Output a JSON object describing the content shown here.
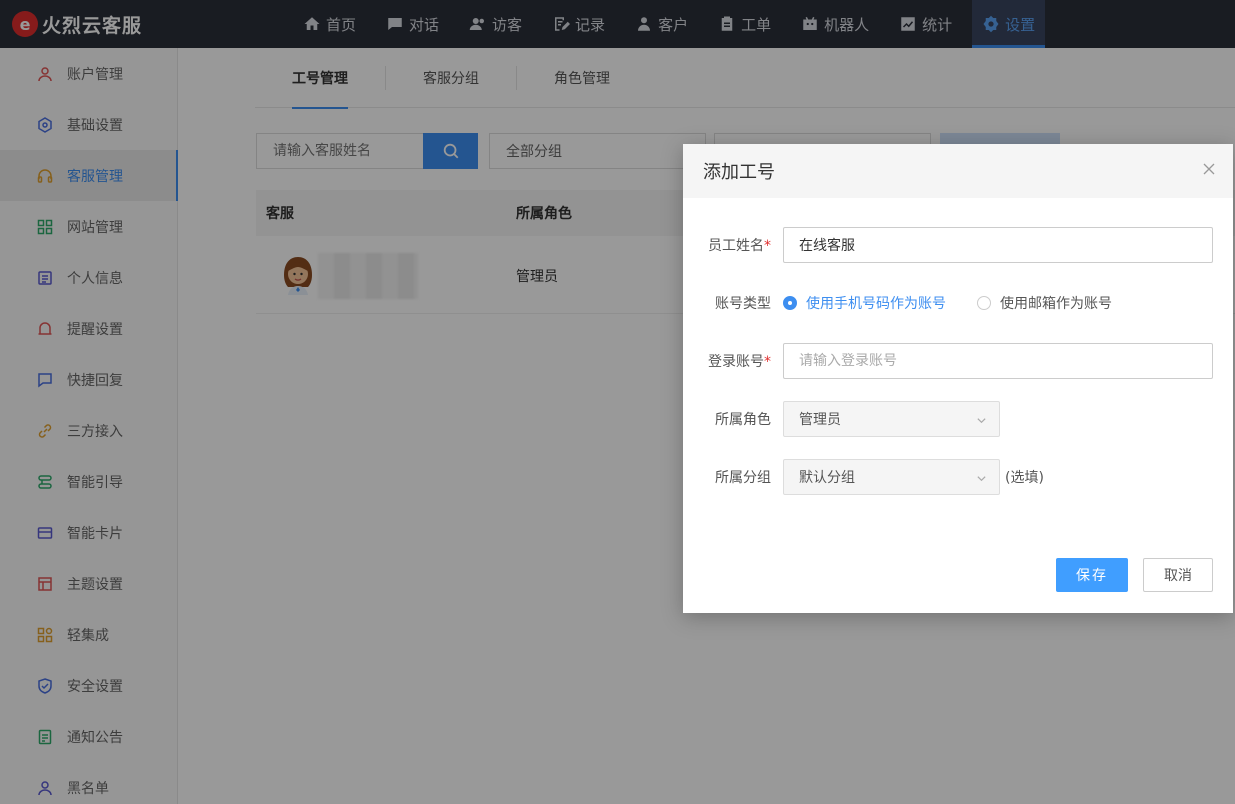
{
  "app": {
    "title": "火烈云客服"
  },
  "nav": [
    {
      "label": "首页",
      "icon": "home-icon",
      "active": false
    },
    {
      "label": "对话",
      "icon": "chat-icon",
      "active": false
    },
    {
      "label": "访客",
      "icon": "visitor-icon",
      "active": false
    },
    {
      "label": "记录",
      "icon": "record-icon",
      "active": false
    },
    {
      "label": "客户",
      "icon": "customer-icon",
      "active": false
    },
    {
      "label": "工单",
      "icon": "ticket-icon",
      "active": false
    },
    {
      "label": "机器人",
      "icon": "robot-icon",
      "active": false
    },
    {
      "label": "统计",
      "icon": "chart-icon",
      "active": false
    },
    {
      "label": "设置",
      "icon": "gear-icon",
      "active": true
    }
  ],
  "sidebar": {
    "items": [
      {
        "label": "账户管理",
        "icon": "user-icon",
        "color": "#e05555"
      },
      {
        "label": "基础设置",
        "icon": "hexagon-icon",
        "color": "#4a6fe0"
      },
      {
        "label": "客服管理",
        "icon": "headset-icon",
        "color": "#e0a030",
        "active": true
      },
      {
        "label": "网站管理",
        "icon": "grid-icon",
        "color": "#2eaa6b"
      },
      {
        "label": "个人信息",
        "icon": "profile-icon",
        "color": "#5a5ad0"
      },
      {
        "label": "提醒设置",
        "icon": "bell-icon",
        "color": "#e05555"
      },
      {
        "label": "快捷回复",
        "icon": "message-icon",
        "color": "#4a6fe0"
      },
      {
        "label": "三方接入",
        "icon": "link-icon",
        "color": "#e0a030"
      },
      {
        "label": "智能引导",
        "icon": "guide-icon",
        "color": "#2eaa6b"
      },
      {
        "label": "智能卡片",
        "icon": "card-icon",
        "color": "#5a5ad0"
      },
      {
        "label": "主题设置",
        "icon": "theme-icon",
        "color": "#e05555"
      },
      {
        "label": "轻集成",
        "icon": "integration-icon",
        "color": "#e0a030"
      },
      {
        "label": "安全设置",
        "icon": "shield-icon",
        "color": "#4a6fe0"
      },
      {
        "label": "通知公告",
        "icon": "notice-icon",
        "color": "#2eaa6b"
      },
      {
        "label": "黑名单",
        "icon": "blacklist-icon",
        "color": "#5a5ad0"
      }
    ]
  },
  "tabs": [
    {
      "label": "工号管理",
      "active": true
    },
    {
      "label": "客服分组",
      "active": false
    },
    {
      "label": "角色管理",
      "active": false
    }
  ],
  "filters": {
    "search_placeholder": "请输入客服姓名",
    "group_value": "全部分组"
  },
  "table": {
    "columns": [
      "客服",
      "所属角色"
    ],
    "rows": [
      {
        "role": "管理员"
      }
    ]
  },
  "modal": {
    "title": "添加工号",
    "fields": {
      "name_label": "员工姓名",
      "name_value": "在线客服",
      "account_type_label": "账号类型",
      "account_type_options": [
        "使用手机号码作为账号",
        "使用邮箱作为账号"
      ],
      "login_label": "登录账号",
      "login_placeholder": "请输入登录账号",
      "role_label": "所属角色",
      "role_value": "管理员",
      "group_label": "所属分组",
      "group_value": "默认分组",
      "group_optional": "(选填)"
    },
    "required_mark": "*",
    "save_label": "保存",
    "cancel_label": "取消"
  },
  "colors": {
    "accent": "#3d8ef0",
    "topbar": "#2b2f3a",
    "required": "#e02e2e"
  }
}
